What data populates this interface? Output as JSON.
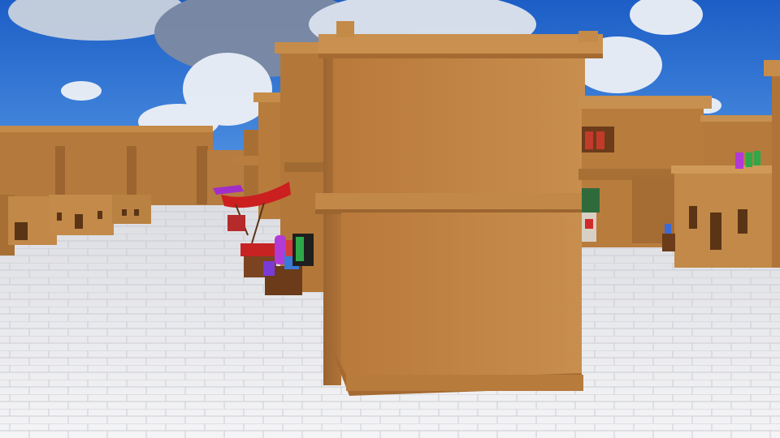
{
  "scene": {
    "description_colors": {
      "sky_top": "#1f63c9",
      "sky_bottom": "#4d93e6",
      "cloud": "#f2f4f8",
      "adobe_light": "#c98f4c",
      "adobe_mid": "#b57a3c",
      "adobe_dark": "#8d5a29",
      "floor": "#e9eaee",
      "floor_line": "#c4c6cc",
      "awning": "#d21f1f",
      "cloth_purple": "#b23ad6",
      "cloth_green": "#2fa84a"
    }
  }
}
